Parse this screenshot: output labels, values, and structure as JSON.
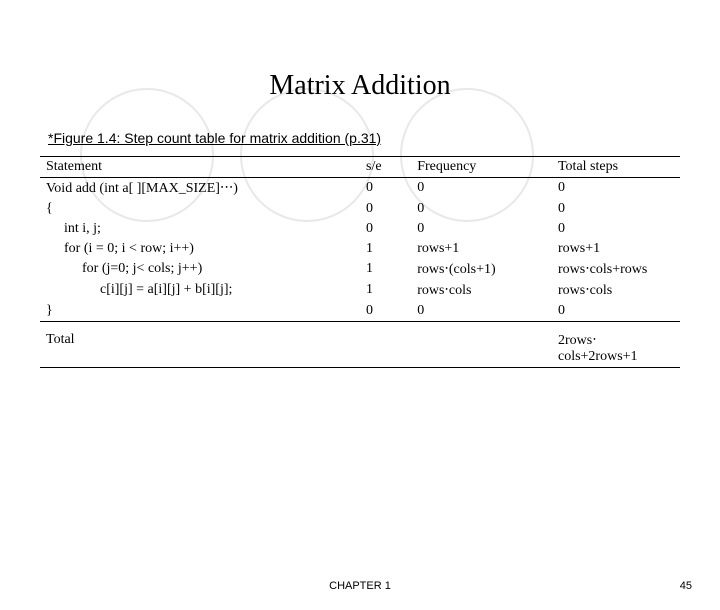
{
  "title": "Matrix Addition",
  "caption": "*Figure 1.4: Step count table for matrix addition (p.31)",
  "table": {
    "headers": {
      "statement": "Statement",
      "sc": "s/e",
      "freq": "Frequency",
      "total": "Total steps"
    },
    "rows": [
      {
        "stmt": "Void add (int a[ ][MAX_SIZE]‧‧‧)",
        "sc": "0",
        "freq": "0",
        "total": "0"
      },
      {
        "stmt": "{",
        "sc": "0",
        "freq": "0",
        "total": "0"
      },
      {
        "stmt": "int i, j;",
        "indent": 1,
        "sc": "0",
        "freq": "0",
        "total": "0"
      },
      {
        "stmt": "for (i = 0; i < row; i++)",
        "indent": 1,
        "sc": "1",
        "freq": "rows+1",
        "total": "rows+1"
      },
      {
        "stmt": "for (j=0; j< cols; j++)",
        "indent": 2,
        "sc": "1",
        "freq": "rows‧(cols+1)",
        "total": "rows‧cols+rows"
      },
      {
        "stmt": "c[i][j] = a[i][j] + b[i][j];",
        "indent": 3,
        "sc": "1",
        "freq": "rows‧cols",
        "total": "rows‧cols"
      },
      {
        "stmt": "}",
        "sc": "0",
        "freq": "0",
        "total": "0"
      }
    ],
    "total_row": {
      "label": "Total",
      "value": "2rows‧cols+2rows+1"
    }
  },
  "footer": {
    "chapter": "CHAPTER 1",
    "page": "45"
  }
}
